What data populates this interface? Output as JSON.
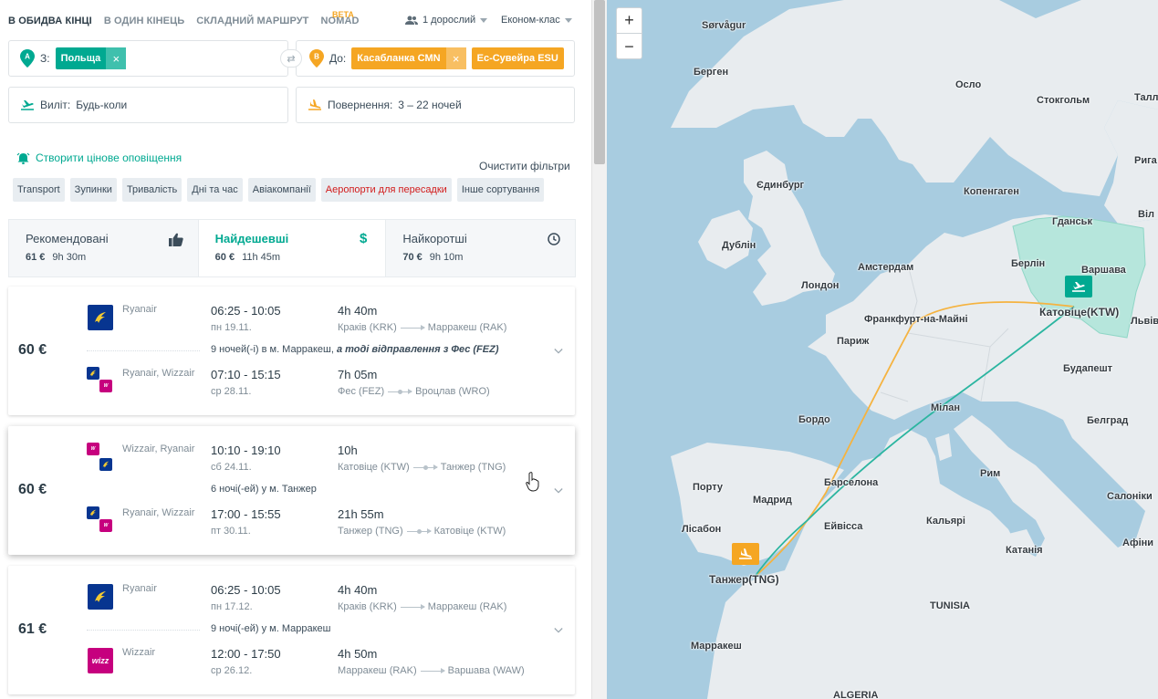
{
  "mode_tabs": [
    {
      "label": "В обидва кінці",
      "active": true
    },
    {
      "label": "В один кінець",
      "active": false
    },
    {
      "label": "Складний маршрут",
      "active": false
    },
    {
      "label": "Nomad",
      "active": false
    }
  ],
  "beta_badge": "BETA",
  "passengers": "1 дорослий",
  "cabin_class": "Економ-клас",
  "from": {
    "pin": "A",
    "label": "З:",
    "chips": [
      "Польща"
    ]
  },
  "to": {
    "pin": "B",
    "label": "До:",
    "chips": [
      "Касабланка CMN",
      "Ес-Сувейра ESU"
    ]
  },
  "departure": {
    "label": "Виліт:",
    "value": "Будь-коли"
  },
  "return": {
    "label": "Повернення:",
    "value": "3 – 22 ночей"
  },
  "price_alert": "Створити цінове оповіщення",
  "clear_filters": "Очистити фільтри",
  "filters": [
    "Transport",
    "Зупинки",
    "Тривалість",
    "Дні та час",
    "Авіакомпанії",
    "Аеропорти для пересадки",
    "Інше сортування"
  ],
  "sort_tabs": [
    {
      "title": "Рекомендовані",
      "price": "61 €",
      "duration": "9h 30m",
      "icon": "thumbs-up-icon"
    },
    {
      "title": "Найдешевші",
      "price": "60 €",
      "duration": "11h 45m",
      "icon": "dollar-icon"
    },
    {
      "title": "Найкоротші",
      "price": "70 €",
      "duration": "9h 10m",
      "icon": "clock-icon"
    }
  ],
  "results": [
    {
      "price": "60 €",
      "stay": "9 ночей(-і) в м. Марракеш,",
      "stay_extra": "а тоді відправлення з Фес (FEZ)",
      "outbound": {
        "airline": "Ryanair",
        "times": "06:25 - 10:05",
        "date": "пн 19.11.",
        "duration": "4h 40m",
        "from": "Краків (KRK)",
        "to": "Марракеш (RAK)",
        "stop": false
      },
      "inbound": {
        "airline": "Ryanair, Wizzair",
        "times": "07:10 - 15:15",
        "date": "ср 28.11.",
        "duration": "7h 05m",
        "from": "Фес (FEZ)",
        "to": "Вроцлав (WRO)",
        "stop": true
      }
    },
    {
      "price": "60 €",
      "stay": "6 ночі(-ей) у м. Танжер",
      "stay_extra": "",
      "outbound": {
        "airline": "Wizzair, Ryanair",
        "times": "10:10 - 19:10",
        "date": "сб 24.11.",
        "duration": "10h",
        "from": "Катовіце (KTW)",
        "to": "Танжер (TNG)",
        "stop": true
      },
      "inbound": {
        "airline": "Ryanair, Wizzair",
        "times": "17:00 - 15:55",
        "date": "пт 30.11.",
        "duration": "21h 55m",
        "from": "Танжер (TNG)",
        "to": "Катовіце (KTW)",
        "stop": true
      }
    },
    {
      "price": "61 €",
      "stay": "9 ночі(-ей) у м. Марракеш",
      "stay_extra": "",
      "outbound": {
        "airline": "Ryanair",
        "times": "06:25 - 10:05",
        "date": "пн 17.12.",
        "duration": "4h 40m",
        "from": "Краків (KRK)",
        "to": "Марракеш (RAK)",
        "stop": false
      },
      "inbound": {
        "airline": "Wizzair",
        "times": "12:00 - 17:50",
        "date": "ср 26.12.",
        "duration": "4h 50m",
        "from": "Марракеш (RAK)",
        "to": "Варшава (WAW)",
        "stop": false
      }
    }
  ],
  "map": {
    "zoom_in": "+",
    "zoom_out": "−",
    "cities": [
      "Sørvågur",
      "Берген",
      "Осло",
      "Стокгольм",
      "Талл",
      "Рига",
      "Єдинбург",
      "Копенгаген",
      "Гданськ",
      "Віл",
      "Дублін",
      "Амстердам",
      "Берлін",
      "Варшава",
      "Лондон",
      "Катовіце(KTW)",
      "Львів",
      "Франкфурт-на-Майні",
      "Париж",
      "Будапешт",
      "Бордо",
      "Мілан",
      "Белград",
      "Порту",
      "Барселона",
      "Рим",
      "Салоніки",
      "Мадрид",
      "Лісабон",
      "Ейвісса",
      "Кальярі",
      "Афіни",
      "Катанія",
      "Танжер(TNG)",
      "TUNISIA",
      "Марракеш",
      "ALGERIA"
    ],
    "route_colors": {
      "outbound": "#f5b340",
      "inbound": "#2bb5a0"
    },
    "highlight_color": "#b6e6dc"
  }
}
